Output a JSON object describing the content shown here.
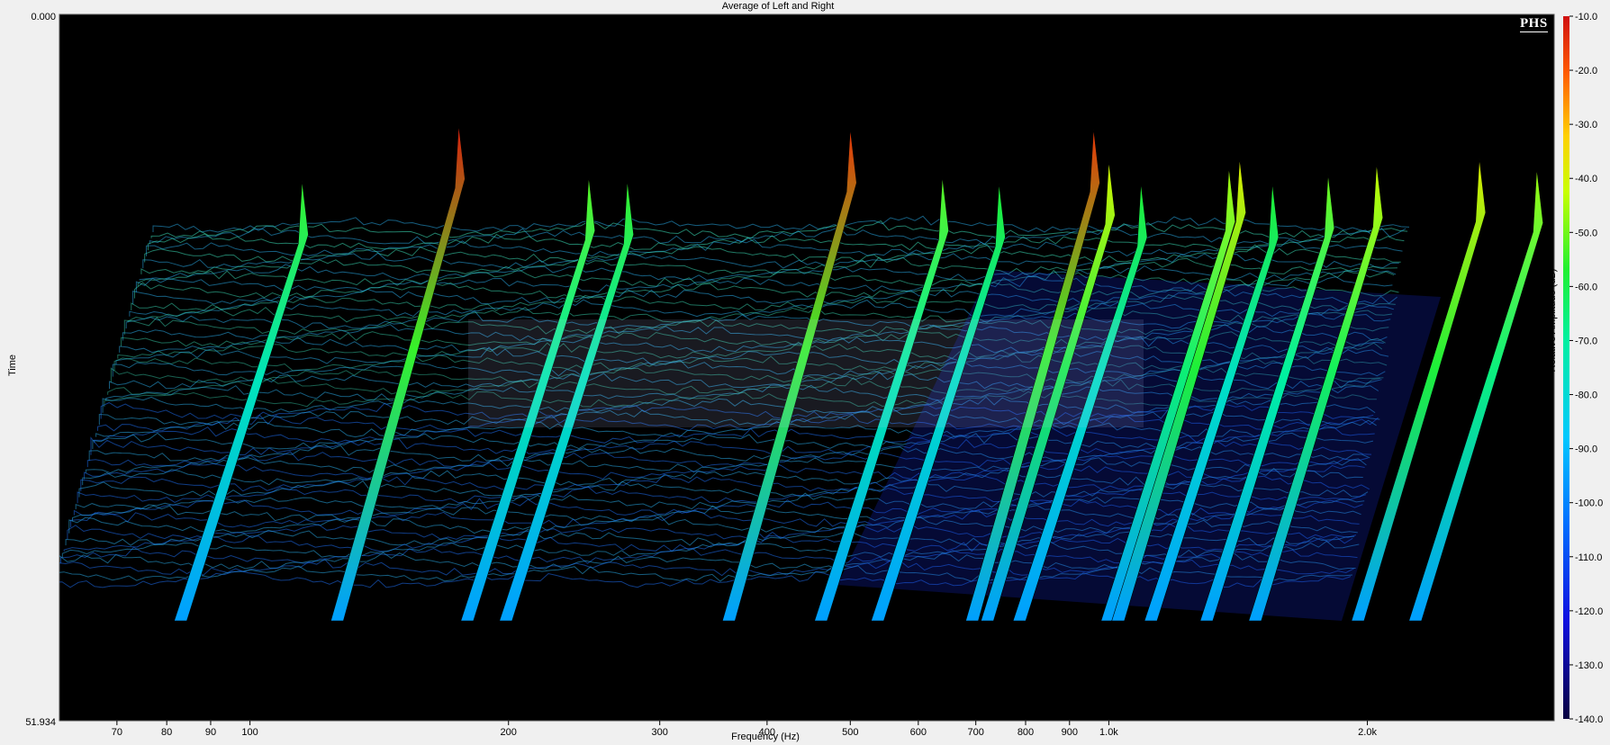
{
  "chart_data": {
    "type": "waterfall",
    "title": "Average of Left and Right",
    "xlabel": "Frequency (Hz)",
    "ylabel": "Time",
    "zlabel": "Relative Amplitude (dB)",
    "x_scale": "log",
    "xlim": [
      60,
      3300
    ],
    "ylim": [
      0.0,
      51.934
    ],
    "zlim": [
      -140,
      -10
    ],
    "x_ticks": [
      "70",
      "80",
      "90",
      "100",
      "200",
      "300",
      "400",
      "500",
      "600",
      "700",
      "800",
      "900",
      "1.0k",
      "2.0k"
    ],
    "x_tick_values": [
      70,
      80,
      90,
      100,
      200,
      300,
      400,
      500,
      600,
      700,
      800,
      900,
      1000,
      2000
    ],
    "y_ticks": [
      "0.000",
      "51.934"
    ],
    "colorbar_ticks": [
      "-10.0",
      "-20.0",
      "-30.0",
      "-40.0",
      "-50.0",
      "-60.0",
      "-70.0",
      "-80.0",
      "-90.0",
      "-100.0",
      "-110.0",
      "-120.0",
      "-130.0",
      "-140.0"
    ],
    "colorbar_values": [
      -10,
      -20,
      -30,
      -40,
      -50,
      -60,
      -70,
      -80,
      -90,
      -100,
      -110,
      -120,
      -130,
      -140
    ],
    "resonance_peaks": [
      {
        "frequency": 115,
        "amplitude": -55
      },
      {
        "frequency": 175,
        "amplitude": -12
      },
      {
        "frequency": 248,
        "amplitude": -52
      },
      {
        "frequency": 275,
        "amplitude": -55
      },
      {
        "frequency": 500,
        "amplitude": -15
      },
      {
        "frequency": 640,
        "amplitude": -52
      },
      {
        "frequency": 745,
        "amplitude": -57
      },
      {
        "frequency": 960,
        "amplitude": -15
      },
      {
        "frequency": 1000,
        "amplitude": -40
      },
      {
        "frequency": 1090,
        "amplitude": -57
      },
      {
        "frequency": 1380,
        "amplitude": -45
      },
      {
        "frequency": 1420,
        "amplitude": -38
      },
      {
        "frequency": 1550,
        "amplitude": -57
      },
      {
        "frequency": 1800,
        "amplitude": -50
      },
      {
        "frequency": 2050,
        "amplitude": -42
      },
      {
        "frequency": 2700,
        "amplitude": -38
      },
      {
        "frequency": 3150,
        "amplitude": -46
      }
    ]
  },
  "logo_text": "PHS"
}
